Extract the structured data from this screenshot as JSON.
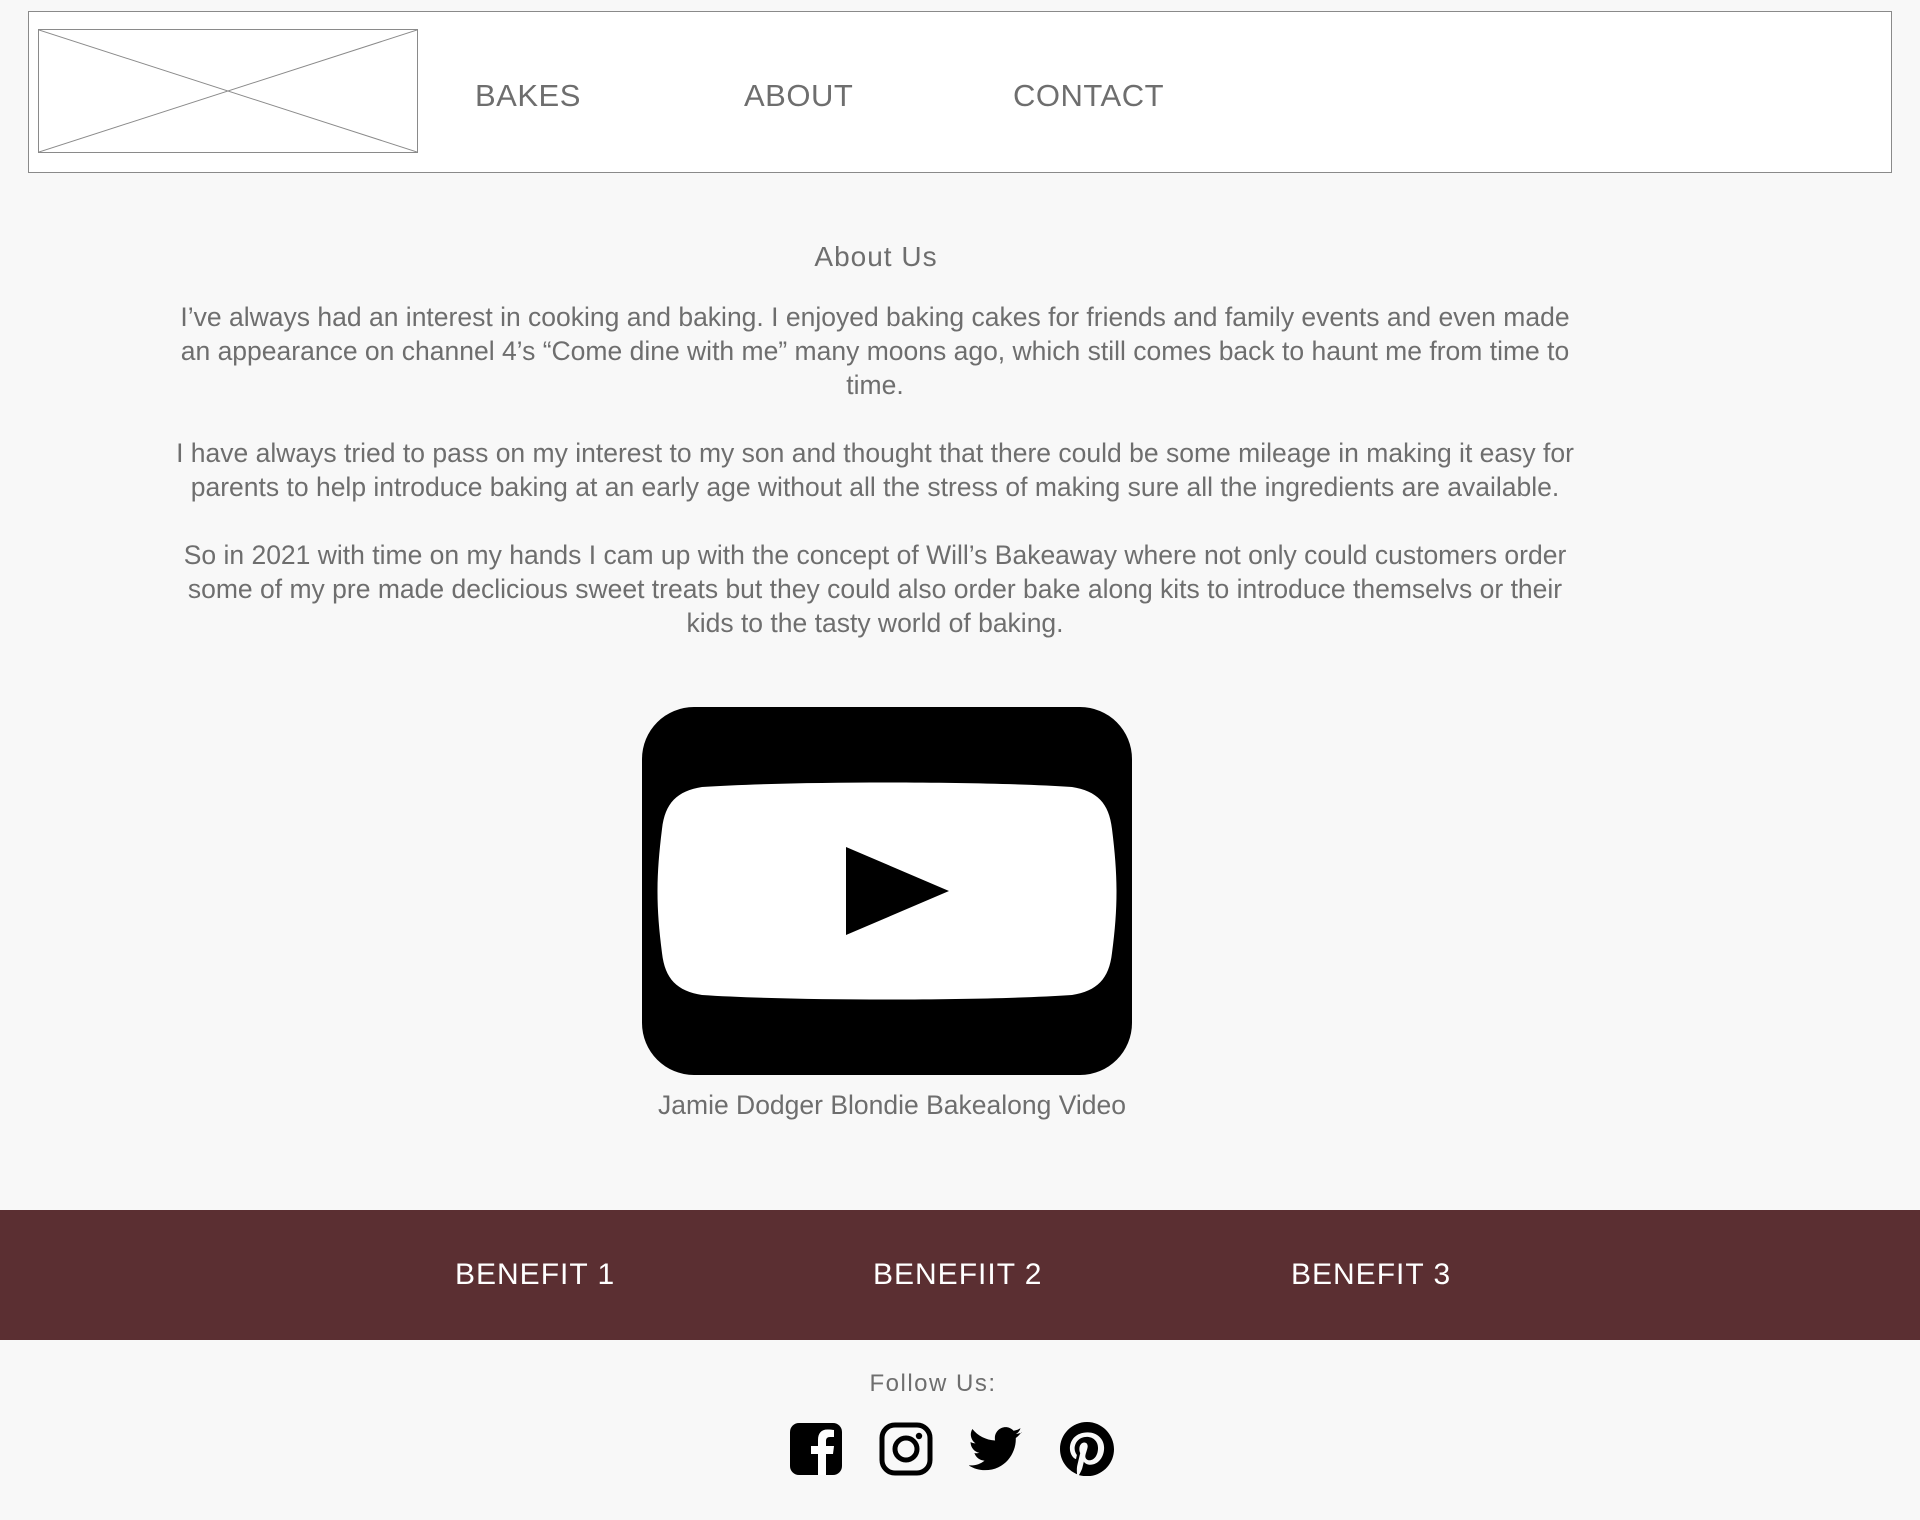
{
  "nav": {
    "logo": "logo-placeholder",
    "links": [
      "BAKES",
      "ABOUT",
      "CONTACT"
    ]
  },
  "about": {
    "title": "About Us",
    "paragraphs": [
      "I’ve always had an interest in cooking and baking. I enjoyed baking cakes for friends and family events and even made an appearance on channel 4’s “Come dine with me” many moons ago, which still comes back to haunt me from time to time.",
      "I have always tried to pass on my interest to my son and thought that there could be some mileage in making it easy for parents to help introduce baking at an early age without all the stress of making sure all the ingredients are available.",
      "So in 2021 with time on my hands I cam up with the concept of Will’s Bakeaway where not only could customers order some of my pre made declicious sweet treats but they could also order bake along kits to introduce themselvs or their kids to the tasty world of baking."
    ]
  },
  "video": {
    "icon": "youtube-play-icon",
    "caption": "Jamie Dodger Blondie Bakealong Video"
  },
  "benefits": [
    "BENEFIT 1",
    "BENEFIIT 2",
    "BENEFIT 3"
  ],
  "footer": {
    "follow_label": "Follow Us:",
    "social_icons": [
      "facebook-icon",
      "instagram-icon",
      "twitter-icon",
      "pinterest-icon"
    ]
  },
  "colors": {
    "page_background": "#f8f8f8",
    "text": "#6e6e6e",
    "benefits_bar": "#5b2f32",
    "benefit_text": "#ffffff",
    "border": "#8a8a8a"
  }
}
